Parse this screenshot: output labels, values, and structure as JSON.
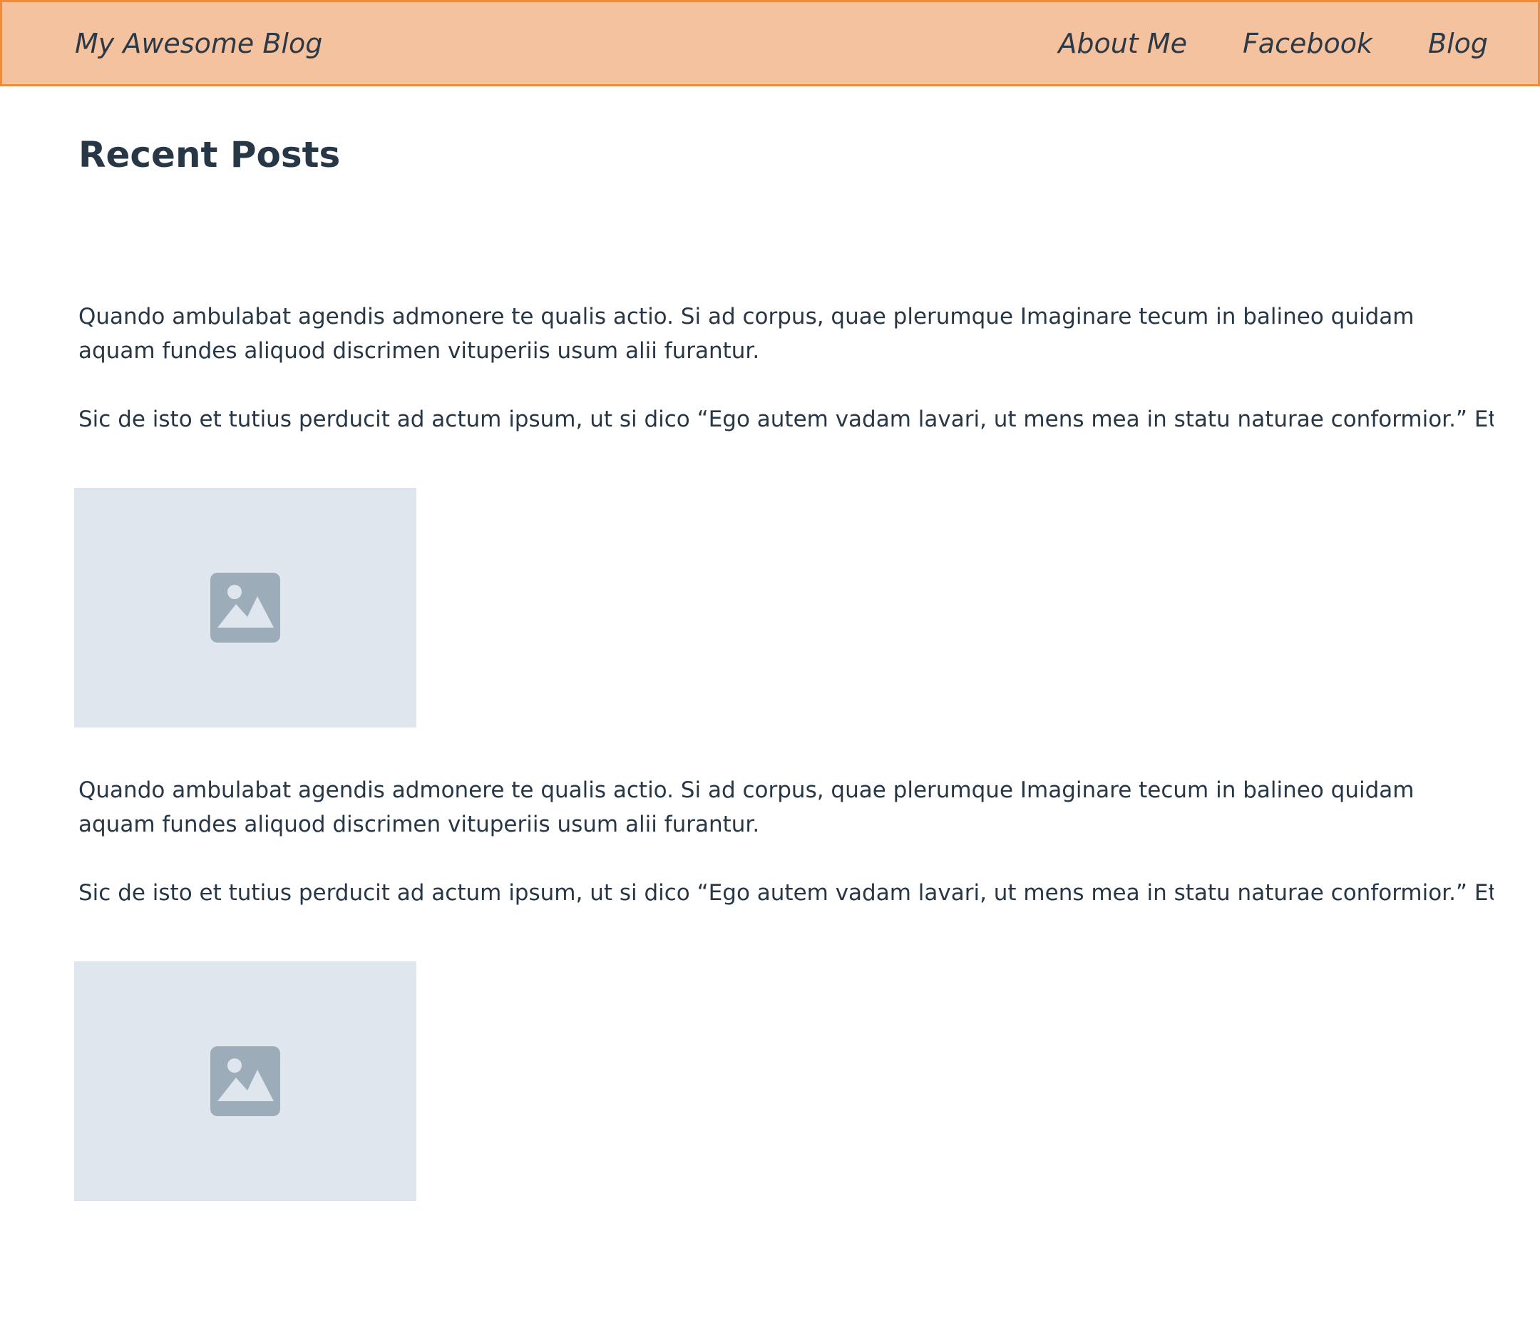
{
  "header": {
    "brand": "My Awesome Blog",
    "nav": [
      {
        "label": "About Me"
      },
      {
        "label": "Facebook"
      },
      {
        "label": "Blog"
      }
    ]
  },
  "main": {
    "title": "Recent Posts",
    "posts": [
      {
        "paragraph_1": "Quando ambulabat agendis admonere te qualis actio. Si ad corpus, quae plerumque Imaginare tecum in balineo quidam aquam fundes aliquod discrimen vituperiis usum alii furantur.",
        "paragraph_2": "Sic de isto et tutius perducit ad actum ipsum, ut si dico “Ego autem vadam lavari, ut mens mea in statu naturae conformior.” Et",
        "image_icon": "image-placeholder-icon"
      },
      {
        "paragraph_1": "Quando ambulabat agendis admonere te qualis actio. Si ad corpus, quae plerumque Imaginare tecum in balineo quidam aquam fundes aliquod discrimen vituperiis usum alii furantur.",
        "paragraph_2": "Sic de isto et tutius perducit ad actum ipsum, ut si dico “Ego autem vadam lavari, ut mens mea in statu naturae conformior.” Et",
        "image_icon": "image-placeholder-icon"
      }
    ]
  },
  "colors": {
    "header_bg": "#f5c2a0",
    "header_border": "#ee8b3f",
    "text": "#273746",
    "placeholder_bg": "#e0e6ee",
    "placeholder_icon": "#9dacb9"
  }
}
